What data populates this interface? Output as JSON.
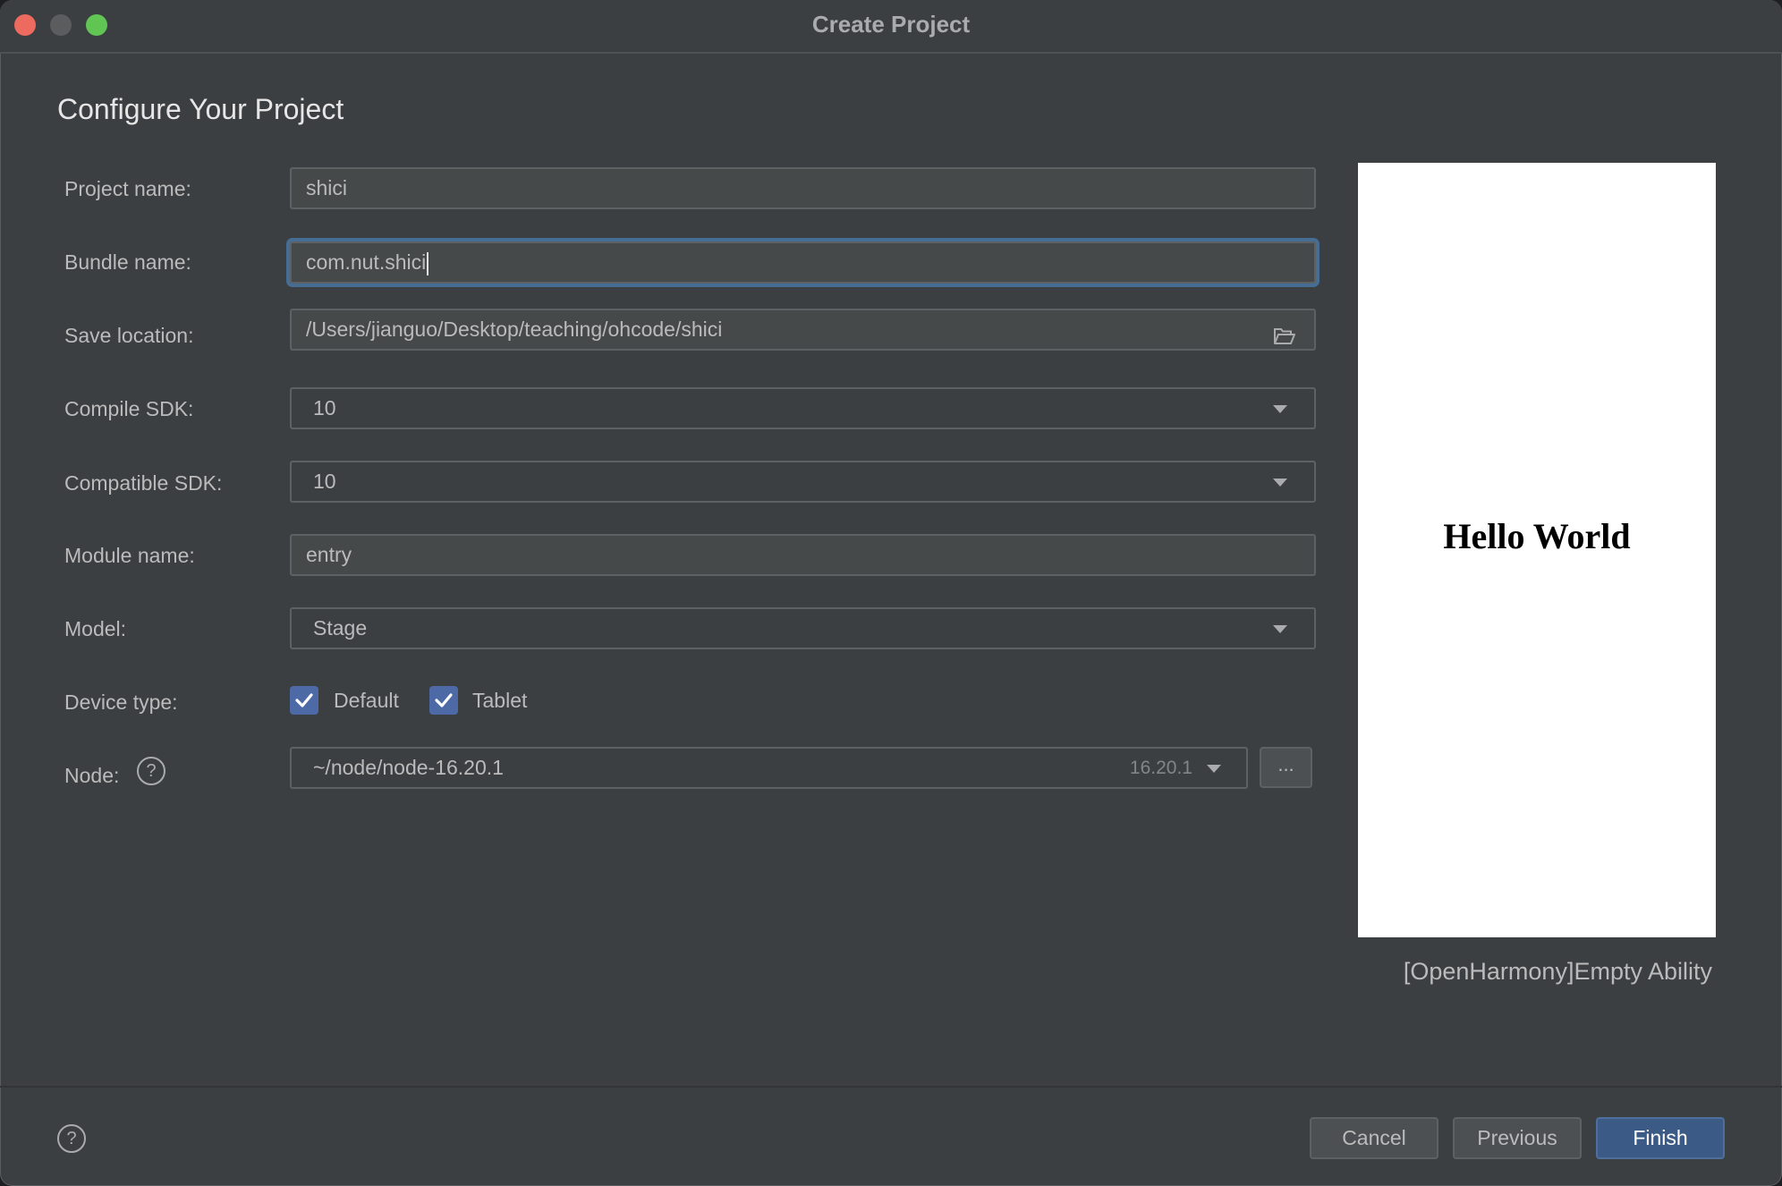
{
  "window": {
    "title": "Create Project",
    "controls": [
      "close",
      "minimize",
      "maximize"
    ]
  },
  "page": {
    "heading": "Configure Your Project"
  },
  "form": {
    "project_name": {
      "label": "Project name:",
      "value": "shici"
    },
    "bundle_name": {
      "label": "Bundle name:",
      "value": "com.nut.shici"
    },
    "save_location": {
      "label": "Save location:",
      "value": "/Users/jianguo/Desktop/teaching/ohcode/shici",
      "icon": "folder-open-icon"
    },
    "compile_sdk": {
      "label": "Compile SDK:",
      "value": "10"
    },
    "compatible_sdk": {
      "label": "Compatible SDK:",
      "value": "10"
    },
    "module_name": {
      "label": "Module name:",
      "value": "entry"
    },
    "model": {
      "label": "Model:",
      "value": "Stage"
    },
    "device_type": {
      "label": "Device type:",
      "options": [
        {
          "label": "Default",
          "checked": true
        },
        {
          "label": "Tablet",
          "checked": true
        }
      ]
    },
    "node": {
      "label": "Node:",
      "value": "~/node/node-16.20.1",
      "version": "16.20.1",
      "browse_label": "...",
      "help_glyph": "?"
    }
  },
  "preview": {
    "text": "Hello World",
    "template_name": "[OpenHarmony]Empty Ability"
  },
  "footer": {
    "help_glyph": "?",
    "cancel_label": "Cancel",
    "previous_label": "Previous",
    "finish_label": "Finish"
  },
  "colors": {
    "background": "#3c3f41",
    "accent": "#3c5a86",
    "checkbox": "#4d6aa7",
    "focus_ring": "#466d94"
  }
}
